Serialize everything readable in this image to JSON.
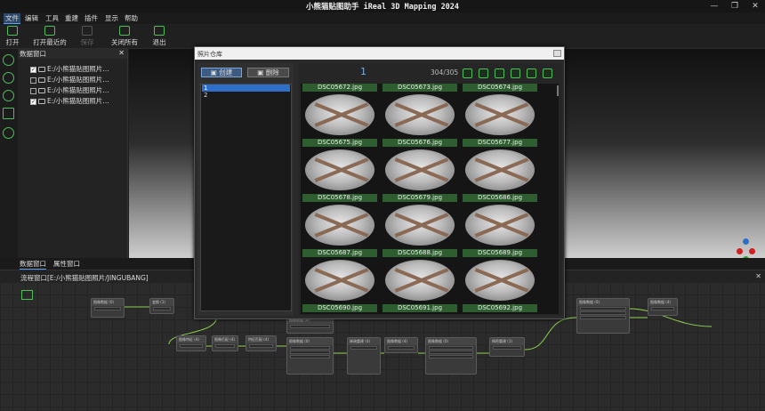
{
  "window": {
    "title": "小熊猫贴图助手 iReal 3D Mapping 2024",
    "controls": [
      "—",
      "❐",
      "✕"
    ]
  },
  "menu": [
    "文件",
    "编辑",
    "工具",
    "重建",
    "插件",
    "显示",
    "帮助"
  ],
  "toolbar": {
    "open": "打开",
    "open_recent": "打开最近的",
    "save": "保存",
    "close_all": "关闭所有",
    "exit": "退出"
  },
  "data_panel": {
    "title": "数据窗口",
    "close": "✕",
    "items": [
      {
        "label": "E:/小熊猫贴图照片…",
        "checked": true
      },
      {
        "label": "E:/小熊猫贴图照片…",
        "checked": false
      },
      {
        "label": "E:/小熊猫贴图照片…",
        "checked": false
      },
      {
        "label": "E:/小熊猫贴图照片…",
        "checked": true
      }
    ]
  },
  "lower_tabs": [
    "数据窗口",
    "属性窗口"
  ],
  "flow_window": {
    "title": "流程窗口[E:/小熊猫贴图照片/JINGUBANG]",
    "close": "✕"
  },
  "flow_nodes": [
    {
      "title": "图像数据 (0)"
    },
    {
      "title": "变换 (1)"
    },
    {
      "title": "图像特征 (4)"
    },
    {
      "title": "图像匹配 (4)"
    },
    {
      "title": "特征匹配 (4)"
    },
    {
      "title": "图像数据 (0)"
    },
    {
      "title": "图像数据 (0)"
    },
    {
      "title": "稀疏重建 (4)"
    },
    {
      "title": "图像数据 (4)"
    },
    {
      "title": "图像数据 (0)"
    },
    {
      "title": "稠密重建 (1)"
    },
    {
      "title": "图像数据 (0)"
    },
    {
      "title": "图像数据 (4)"
    }
  ],
  "photo_dialog": {
    "title": "照片仓库",
    "create_btn": "创建",
    "delete_btn": "删除",
    "albums": [
      "1",
      "2"
    ],
    "selected_album": "1",
    "page": "1",
    "counter": "304/305",
    "photos": [
      "DSC05672.jpg",
      "DSC05673.jpg",
      "DSC05674.jpg",
      "DSC05675.jpg",
      "DSC05676.jpg",
      "DSC05677.jpg",
      "DSC05678.jpg",
      "DSC05679.jpg",
      "DSC05686.jpg",
      "DSC05687.jpg",
      "DSC05688.jpg",
      "DSC05689.jpg",
      "DSC05690.jpg",
      "DSC05691.jpg",
      "DSC05692.jpg"
    ]
  },
  "colors": {
    "accent": "#4fbf5a",
    "selection": "#2f6fc9",
    "label_bg": "#2e5d2f"
  }
}
